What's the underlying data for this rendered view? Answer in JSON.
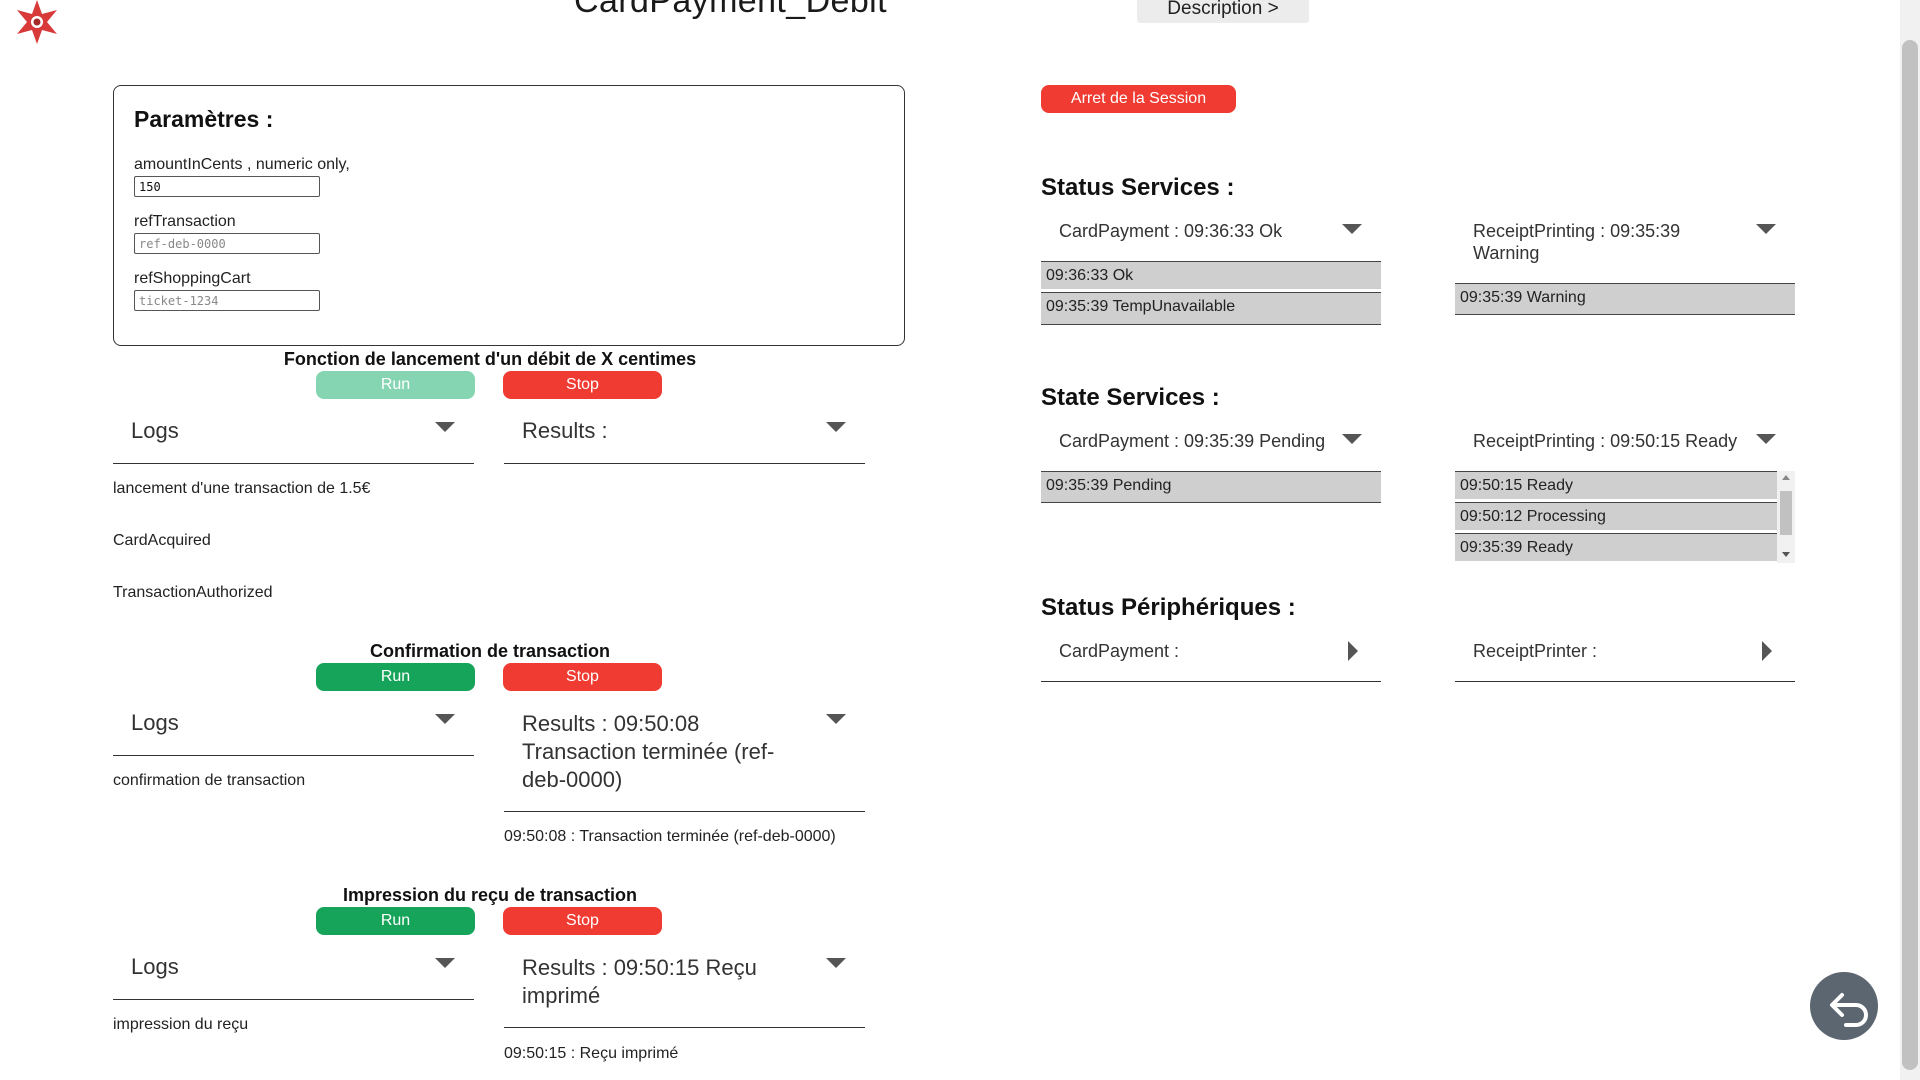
{
  "page": {
    "title": "CardPayment_Debit",
    "description_button": "Description >"
  },
  "params": {
    "title": "Paramètres :",
    "fields": [
      {
        "label": "amountInCents , numeric only,",
        "value": "150",
        "placeholder": ""
      },
      {
        "label": "refTransaction",
        "value": "",
        "placeholder": "ref-deb-0000"
      },
      {
        "label": "refShoppingCart",
        "value": "",
        "placeholder": "ticket-1234"
      }
    ]
  },
  "sections": [
    {
      "heading": "Fonction de lancement d'un débit de X centimes",
      "run": "Run",
      "stop": "Stop",
      "logs_label": "Logs",
      "results_label": "Results :",
      "logs": [
        "lancement d'une transaction de 1.5€",
        "CardAcquired",
        "TransactionAuthorized"
      ],
      "results": []
    },
    {
      "heading": "Confirmation de transaction",
      "run": "Run",
      "stop": "Stop",
      "logs_label": "Logs",
      "results_label": "Results : 09:50:08 Transaction terminée (ref-deb-0000)",
      "logs": [
        "confirmation de transaction"
      ],
      "results": [
        "09:50:08 : Transaction terminée (ref-deb-0000)"
      ]
    },
    {
      "heading": "Impression du reçu de transaction",
      "run": "Run",
      "stop": "Stop",
      "logs_label": "Logs",
      "results_label": "Results : 09:50:15 Reçu imprimé",
      "logs": [
        "impression du reçu"
      ],
      "results": [
        "09:50:15 : Reçu imprimé"
      ]
    }
  ],
  "session": {
    "stop_label": "Arret de la Session"
  },
  "status_services": {
    "title": "Status Services :",
    "card_payment": {
      "label": "CardPayment : 09:36:33 Ok",
      "history": [
        "09:36:33 Ok",
        "09:35:39 TempUnavailable"
      ]
    },
    "receipt_printing": {
      "label": "ReceiptPrinting : 09:35:39 Warning",
      "history": [
        "09:35:39 Warning"
      ]
    }
  },
  "state_services": {
    "title": "State Services :",
    "card_payment": {
      "label": "CardPayment : 09:35:39 Pending",
      "history": [
        "09:35:39 Pending"
      ]
    },
    "receipt_printing": {
      "label": "ReceiptPrinting : 09:50:15 Ready",
      "history": [
        "09:50:15 Ready",
        "09:50:12 Processing",
        "09:35:39 Ready"
      ]
    }
  },
  "status_peripheriques": {
    "title": "Status Périphériques :",
    "card_payment": {
      "label": "CardPayment :"
    },
    "receipt_printer": {
      "label": "ReceiptPrinter :"
    }
  },
  "colors": {
    "run": "#16a35a",
    "run_disabled": "#86d5b2",
    "stop": "#ef3b32",
    "history_bg": "#cfcfcf"
  },
  "icons": {
    "logo": "star-logo-icon",
    "back": "back-arrow-icon"
  }
}
